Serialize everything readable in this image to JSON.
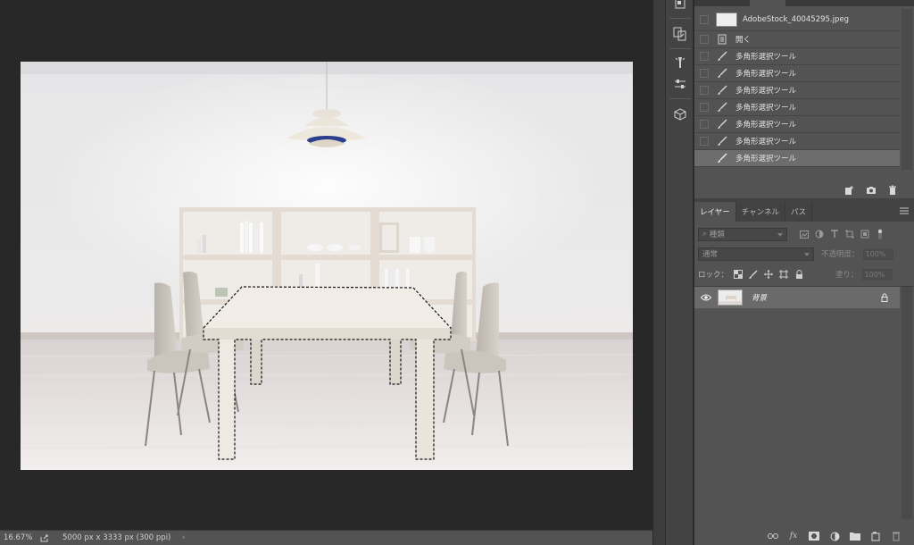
{
  "status": {
    "zoom": "16.67%",
    "doc_info": "5000 px x 3333 px (300 ppi)",
    "arrow": "›"
  },
  "history": {
    "snapshot_name": "AdobeStock_40045295.jpeg",
    "items": [
      {
        "label": "開く",
        "icon": "document-icon"
      },
      {
        "label": "多角形選択ツール",
        "icon": "brush-icon"
      },
      {
        "label": "多角形選択ツール",
        "icon": "brush-icon"
      },
      {
        "label": "多角形選択ツール",
        "icon": "brush-icon"
      },
      {
        "label": "多角形選択ツール",
        "icon": "brush-icon"
      },
      {
        "label": "多角形選択ツール",
        "icon": "brush-icon"
      },
      {
        "label": "多角形選択ツール",
        "icon": "brush-icon"
      },
      {
        "label": "多角形選択ツール",
        "icon": "brush-icon"
      }
    ],
    "selected_index": 7
  },
  "layers": {
    "tabs": [
      "レイヤー",
      "チャンネル",
      "パス"
    ],
    "active_tab": 0,
    "filter_kind": "種類",
    "blend_mode": "通常",
    "opacity_label": "不透明度：",
    "opacity_value": "100%",
    "lock_label": "ロック：",
    "fill_label": "塗り：",
    "fill_value": "100%",
    "layer_name": "背景"
  },
  "colors": {
    "canvas_bg": "#282828",
    "panel_bg": "#535353",
    "selection_highlight": "#6d6d6d",
    "layer_selected": "#6a6a6a"
  }
}
